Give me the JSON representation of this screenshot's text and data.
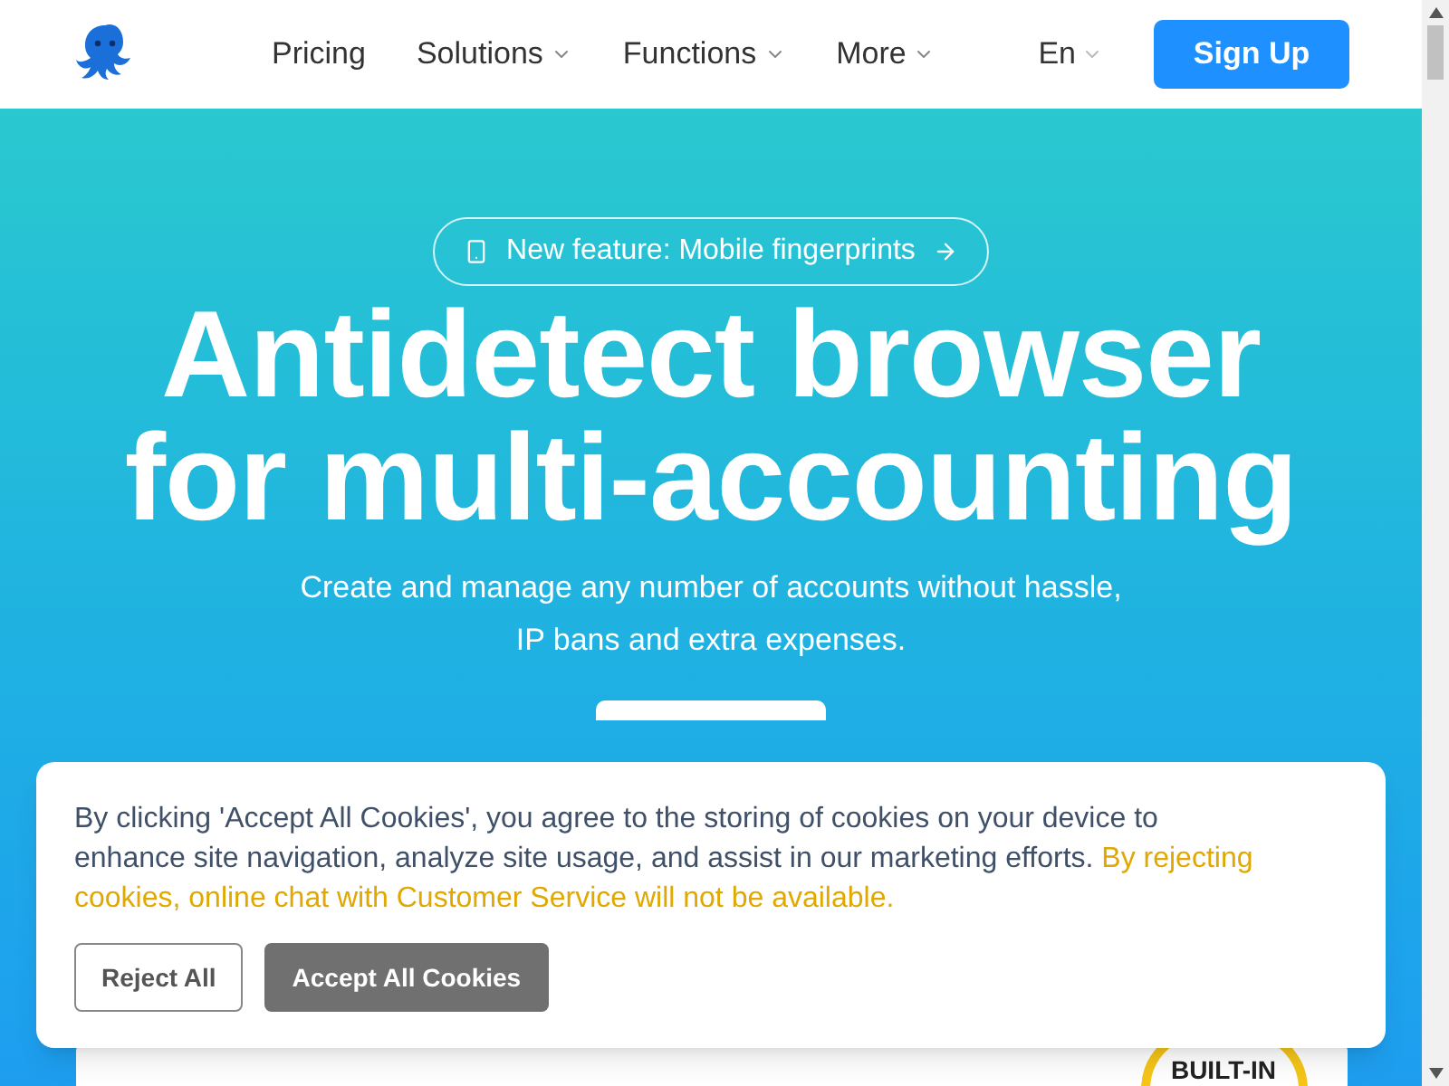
{
  "nav": {
    "items": [
      {
        "label": "Pricing",
        "dropdown": false
      },
      {
        "label": "Solutions",
        "dropdown": true
      },
      {
        "label": "Functions",
        "dropdown": true
      },
      {
        "label": "More",
        "dropdown": true
      }
    ],
    "language": "En",
    "signup": "Sign Up"
  },
  "hero": {
    "announcement": "New feature: Mobile fingerprints",
    "title_lines": [
      "Antidetect browser",
      "for multi-accounting"
    ],
    "subtitle_lines": [
      "Create and manage any number of accounts without hassle,",
      "IP bans and extra expenses."
    ]
  },
  "preview": {
    "badge": "BUILT-IN"
  },
  "cookie": {
    "text": "By clicking 'Accept All Cookies', you agree to the storing of cookies on your device to enhance site navigation, analyze site usage, and assist in our marketing efforts.",
    "note": "By rejecting cookies, online chat with Customer Service will not be available.",
    "buttons": [
      {
        "label": "Reject All",
        "kind": "outline"
      },
      {
        "label": "Accept All Cookies",
        "kind": "filled"
      }
    ]
  }
}
